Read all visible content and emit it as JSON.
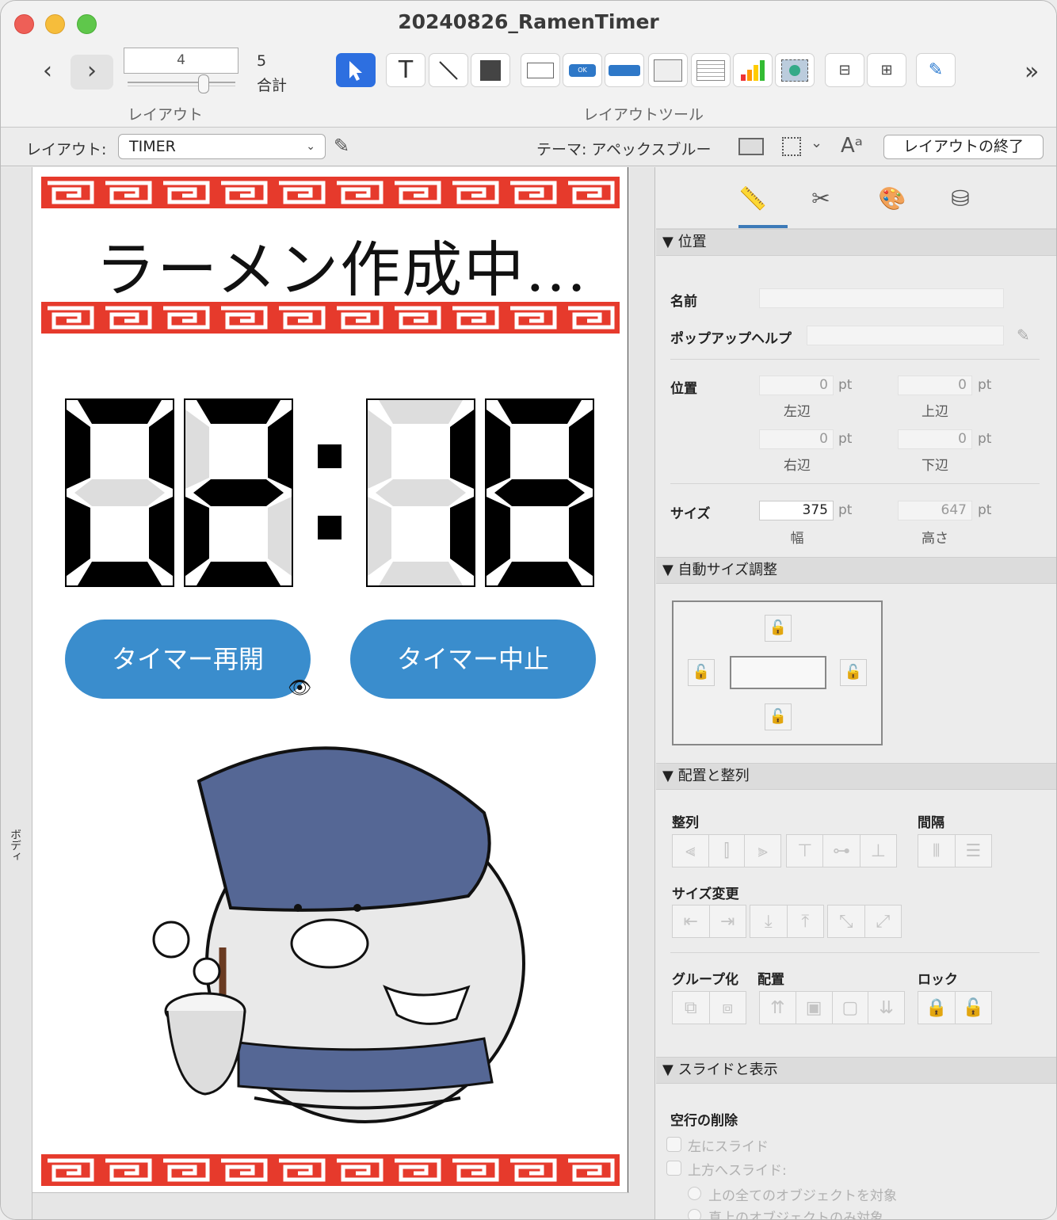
{
  "window": {
    "title": "20240826_RamenTimer"
  },
  "toolbar": {
    "record_field": "4",
    "record_total": "5",
    "total_label": "合計",
    "layout_group_label": "レイアウト",
    "tools_group_label": "レイアウトツール",
    "more": "»"
  },
  "layout_bar": {
    "label": "レイアウト:",
    "selected_layout": "TIMER",
    "theme": "テーマ: アペックスブルー",
    "end_button": "レイアウトの終了"
  },
  "canvas": {
    "part_label": "ボディ",
    "heading": "ラーメン作成中...",
    "timer_digits": [
      "0",
      "2",
      "1",
      "8"
    ],
    "resume_button": "タイマー再開",
    "stop_button": "タイマー中止"
  },
  "inspector": {
    "position_section": "▼ 位置",
    "name_label": "名前",
    "name_value": "",
    "popup_help_label": "ポップアップヘルプ",
    "popup_help_value": "",
    "position_label": "位置",
    "left_value": "0",
    "left_label": "左辺",
    "top_value": "0",
    "top_label": "上辺",
    "right_value": "0",
    "right_label": "右辺",
    "bottom_value": "0",
    "bottom_label": "下辺",
    "unit": "pt",
    "size_label": "サイズ",
    "width_value": "375",
    "width_label": "幅",
    "height_value": "647",
    "height_label": "高さ",
    "autosize_section": "▼ 自動サイズ調整",
    "arrange_section": "▼ 配置と整列",
    "align_label": "整列",
    "spacing_label": "間隔",
    "resize_label": "サイズ変更",
    "group_label": "グループ化",
    "arrange_label": "配置",
    "lock_label": "ロック",
    "slide_section": "▼ スライドと表示",
    "remove_blank_label": "空行の削除",
    "slide_left": "左にスライド",
    "slide_up": "上方へスライド:",
    "radio_all": "上の全てのオブジェクトを対象",
    "radio_direct": "真上のオブジェクトのみ対象"
  },
  "colors": {
    "accent": "#3a8dcd",
    "border_red": "#e63a2c",
    "selected_tool": "#2d6fe0"
  }
}
